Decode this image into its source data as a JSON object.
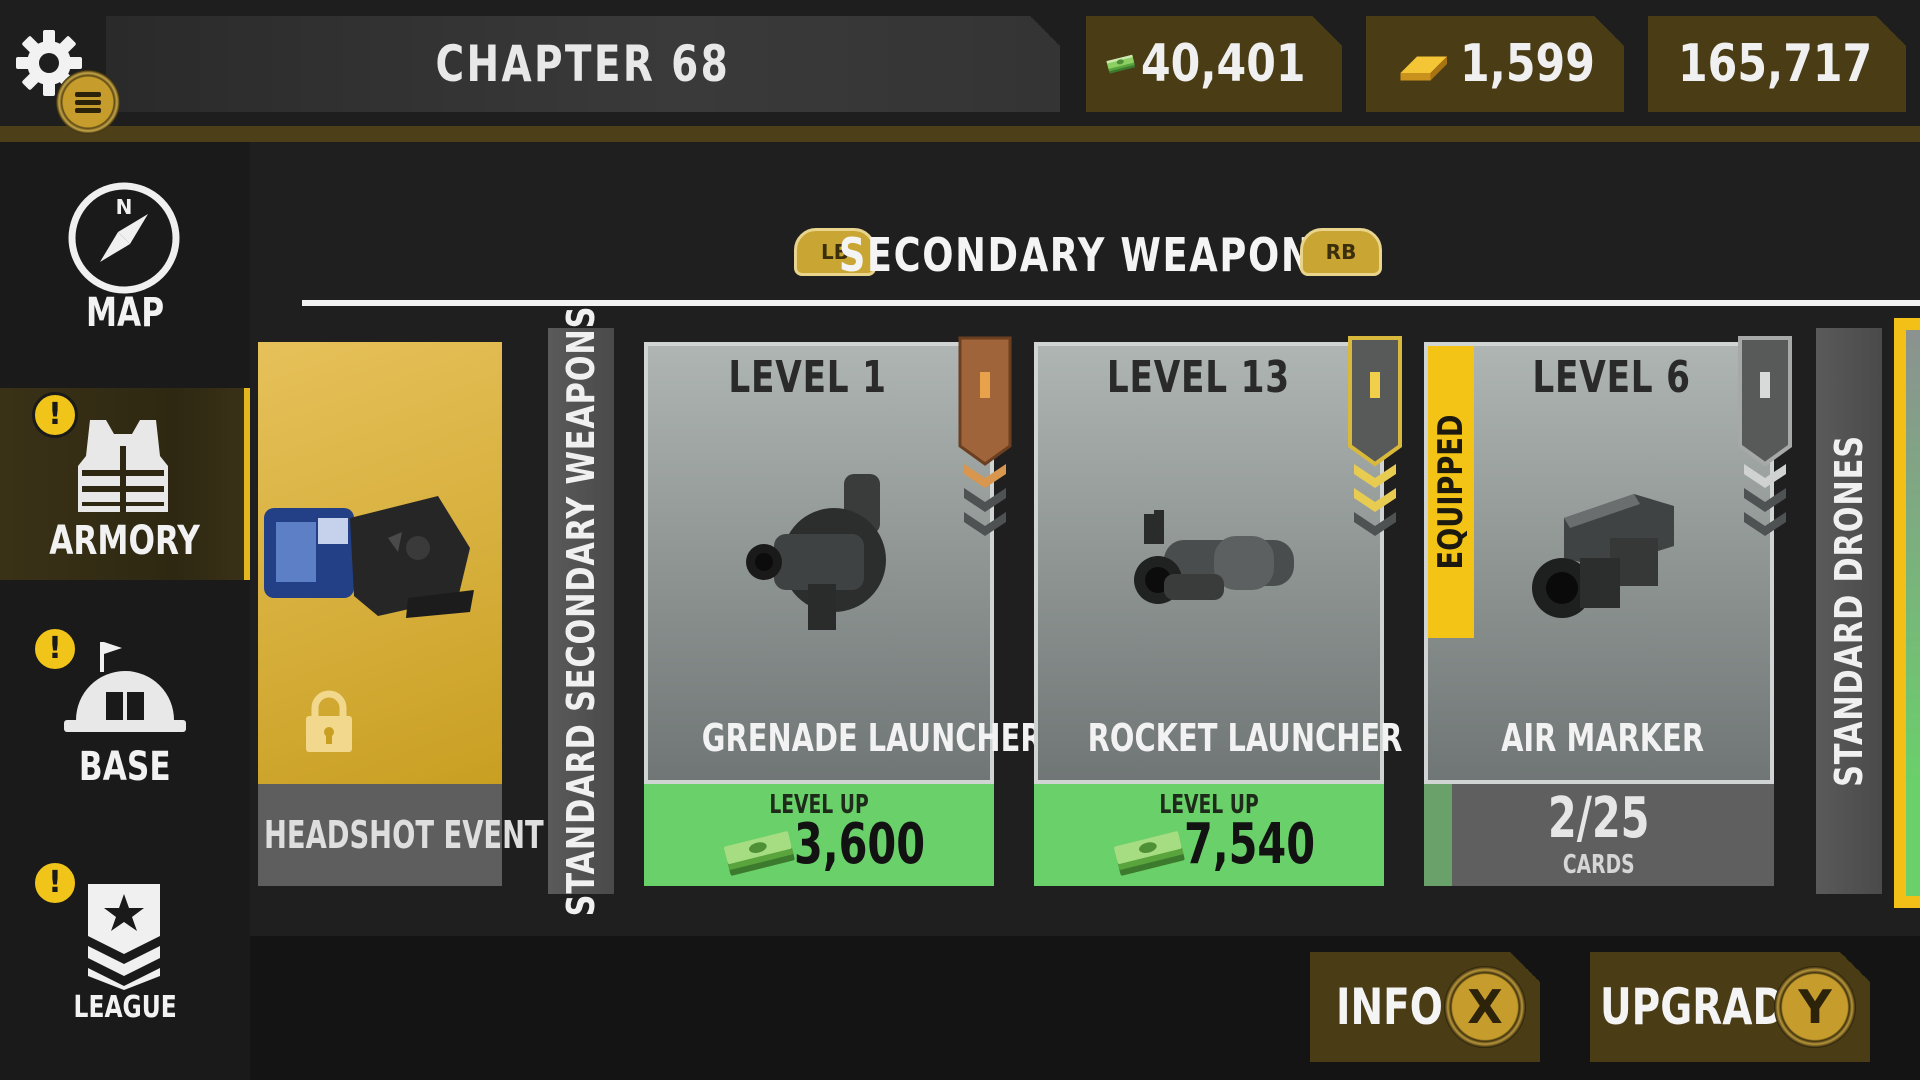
{
  "header": {
    "chapter": "CHAPTER 68",
    "currencies": [
      {
        "icon": "cash-icon",
        "value": "40,401"
      },
      {
        "icon": "gold-bar-icon",
        "value": "1,599"
      },
      {
        "icon": "hex-nut-icon",
        "value": "165,717"
      }
    ]
  },
  "sidebar": {
    "items": [
      {
        "label": "MAP",
        "icon": "compass-icon",
        "alert": false,
        "active": false
      },
      {
        "label": "ARMORY",
        "icon": "vest-icon",
        "alert": true,
        "active": true
      },
      {
        "label": "BASE",
        "icon": "bunker-icon",
        "alert": true,
        "active": false
      },
      {
        "label": "LEAGUE",
        "icon": "rank-chevron-star-icon",
        "alert": true,
        "active": false
      }
    ],
    "alert_glyph": "!"
  },
  "section": {
    "prev_button": "LB",
    "title": "SECONDARY WEAPONS",
    "next_button": "RB"
  },
  "locked_card": {
    "footer": "HEADSHOT EVENT",
    "icon": "lock-icon"
  },
  "tabs": {
    "left": "STANDARD SECONDARY WEAPONS",
    "right": "STANDARD DRONES"
  },
  "weapons": [
    {
      "level": "LEVEL 1",
      "name": "GRENADE LAUNCHER",
      "footer_type": "levelup",
      "levelup_label": "LEVEL UP",
      "cost": "3,600",
      "equipped": false,
      "rank_color": "#a0643a"
    },
    {
      "level": "LEVEL 13",
      "name": "ROCKET LAUNCHER",
      "footer_type": "levelup",
      "levelup_label": "LEVEL UP",
      "cost": "7,540",
      "equipped": false,
      "rank_color": "#d8b93c"
    },
    {
      "level": "LEVEL 6",
      "name": "AIR MARKER",
      "footer_type": "cards",
      "cards": "2/25",
      "cards_label": "CARDS",
      "cards_progress": 0.08,
      "equipped": true,
      "equipped_label": "EQUIPPED",
      "rank_color": "#9a9a9a"
    }
  ],
  "buttons": {
    "info": {
      "label": "INFO",
      "key": "X"
    },
    "upgrade": {
      "label": "UPGRADE",
      "key": "Y"
    }
  },
  "colors": {
    "accent_gold": "#e4b81c",
    "levelup_green": "#6ad06a",
    "panel_brown": "#4a3d15"
  }
}
